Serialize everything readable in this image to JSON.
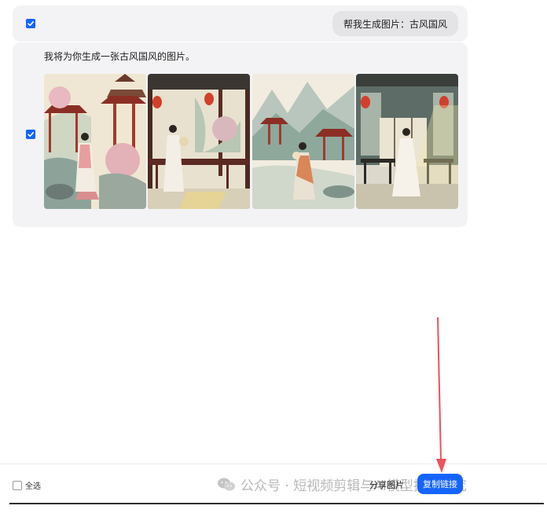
{
  "user_prompt": {
    "text": "帮我生成图片：古风国风"
  },
  "assistant": {
    "text": "我将为你生成一张古风国风的图片。",
    "images": [
      {
        "icon": "ancient-garden-pavilion-woman-image"
      },
      {
        "icon": "veranda-lantern-woman-fan-image"
      },
      {
        "icon": "mountain-pavilion-woman-image"
      },
      {
        "icon": "room-screen-woman-lantern-image"
      }
    ]
  },
  "bottom_bar": {
    "select_all": "全选",
    "watermark": "公众号 · 短视频剪辑与AI模型技术研究",
    "share_image": "分享图片",
    "copy_link": "复制链接"
  },
  "colors": {
    "accent": "#1664ff",
    "panel": "#f3f3f5",
    "bubble": "#e4e4e7",
    "arrow": "#f0505a"
  }
}
